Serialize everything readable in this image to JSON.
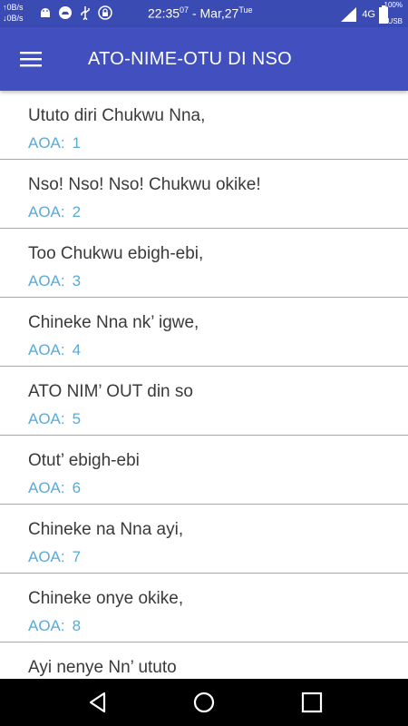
{
  "status_bar": {
    "net_up": "↑0B/s",
    "net_down": "↓0B/s",
    "time": "22:35",
    "time_seconds": "07",
    "date": "- Mar,27",
    "day": "Tue",
    "network": "4G",
    "battery": "100%",
    "usb": "USB",
    "icons": [
      "android-icon",
      "cloud-icon",
      "usb-icon",
      "lock-icon",
      "signal-icon",
      "battery-icon"
    ]
  },
  "app_bar": {
    "title": "ATO-NIME-OTU DI NSO",
    "menu_icon": "hamburger-menu-icon"
  },
  "list": {
    "items": [
      {
        "title": "Ututo diri Chukwu Nna,",
        "label": "AOA:",
        "number": "1"
      },
      {
        "title": "Nso! Nso! Nso! Chukwu okike!",
        "label": "AOA:",
        "number": "2"
      },
      {
        "title": "Too Chukwu ebigh-ebi,",
        "label": "AOA:",
        "number": "3"
      },
      {
        "title": "Chineke Nna nk’ igwe,",
        "label": "AOA:",
        "number": "4"
      },
      {
        "title": "ATO NIM’ OUT din so",
        "label": "AOA:",
        "number": "5"
      },
      {
        "title": "Otut’ ebigh-ebi",
        "label": "AOA:",
        "number": "6"
      },
      {
        "title": "Chineke na Nna ayi,",
        "label": "AOA:",
        "number": "7"
      },
      {
        "title": "Chineke onye okike,",
        "label": "AOA:",
        "number": "8"
      },
      {
        "title": "Ayi nenye Nn’ ututo",
        "label": "",
        "number": ""
      }
    ]
  },
  "nav_bar": {
    "icons": [
      "back-icon",
      "home-icon",
      "recents-icon"
    ]
  },
  "colors": {
    "status_bar": "#3b4bb4",
    "app_bar": "#4250bf",
    "sub_text": "#5aaad6",
    "divider": "#6fb8d9"
  }
}
